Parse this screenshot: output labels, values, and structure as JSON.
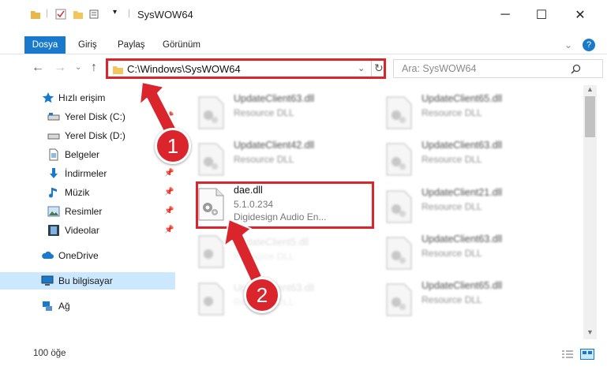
{
  "window": {
    "title": "SysWOW64",
    "controls": {
      "minimize": "─",
      "maximize": "☐",
      "close": "✕"
    }
  },
  "ribbon": {
    "tabs": [
      "Dosya",
      "Giriş",
      "Paylaş",
      "Görünüm"
    ],
    "help": "?"
  },
  "address": {
    "path": "C:\\Windows\\SysWOW64",
    "search_placeholder": "Ara: SysWOW64"
  },
  "sidebar": {
    "items": [
      {
        "label": "Hızlı erişim",
        "icon": "star-icon"
      },
      {
        "label": "Yerel Disk (C:)",
        "icon": "drive-icon",
        "pinned": true
      },
      {
        "label": "Yerel Disk (D:)",
        "icon": "drive-icon",
        "pinned": false
      },
      {
        "label": "Belgeler",
        "icon": "documents-icon",
        "pinned": true
      },
      {
        "label": "İndirmeler",
        "icon": "download-icon",
        "pinned": true
      },
      {
        "label": "Müzik",
        "icon": "music-icon",
        "pinned": true
      },
      {
        "label": "Resimler",
        "icon": "pictures-icon",
        "pinned": true
      },
      {
        "label": "Videolar",
        "icon": "videos-icon",
        "pinned": true
      },
      {
        "label": "OneDrive",
        "icon": "cloud-icon"
      },
      {
        "label": "Bu bilgisayar",
        "icon": "computer-icon",
        "selected": true
      },
      {
        "label": "Ağ",
        "icon": "network-icon"
      }
    ]
  },
  "files": {
    "col1": [
      {
        "name": "UpdateClient63.dll",
        "desc": "Resource DLL"
      },
      {
        "name": "UpdateClient42.dll",
        "desc": "Resource DLL"
      },
      {
        "name": "dae.dll",
        "version": "5.1.0.234",
        "desc": "Digidesign Audio En..."
      }
    ],
    "col2": [
      {
        "name": "UpdateClient65.dll",
        "desc": "Resource DLL"
      },
      {
        "name": "UpdateClient63.dll",
        "desc": "Resource DLL"
      },
      {
        "name": "UpdateClient21.dll",
        "desc": "Resource DLL"
      },
      {
        "name": "UpdateClient63.dll",
        "desc": "Resource DLL"
      },
      {
        "name": "UpdateClient65.dll",
        "desc": "Resource DLL"
      }
    ],
    "col1_lower": [
      {
        "name": "UpdateClient5.dll",
        "desc": "Resource DLL"
      },
      {
        "name": "UpdateClient63.dll",
        "desc": "Resource DLL"
      }
    ]
  },
  "status": {
    "count": "100 öğe"
  },
  "callouts": {
    "one": "1",
    "two": "2"
  },
  "colors": {
    "accent": "#1979ca",
    "highlight": "#d9252b",
    "selected": "#cce8ff"
  }
}
